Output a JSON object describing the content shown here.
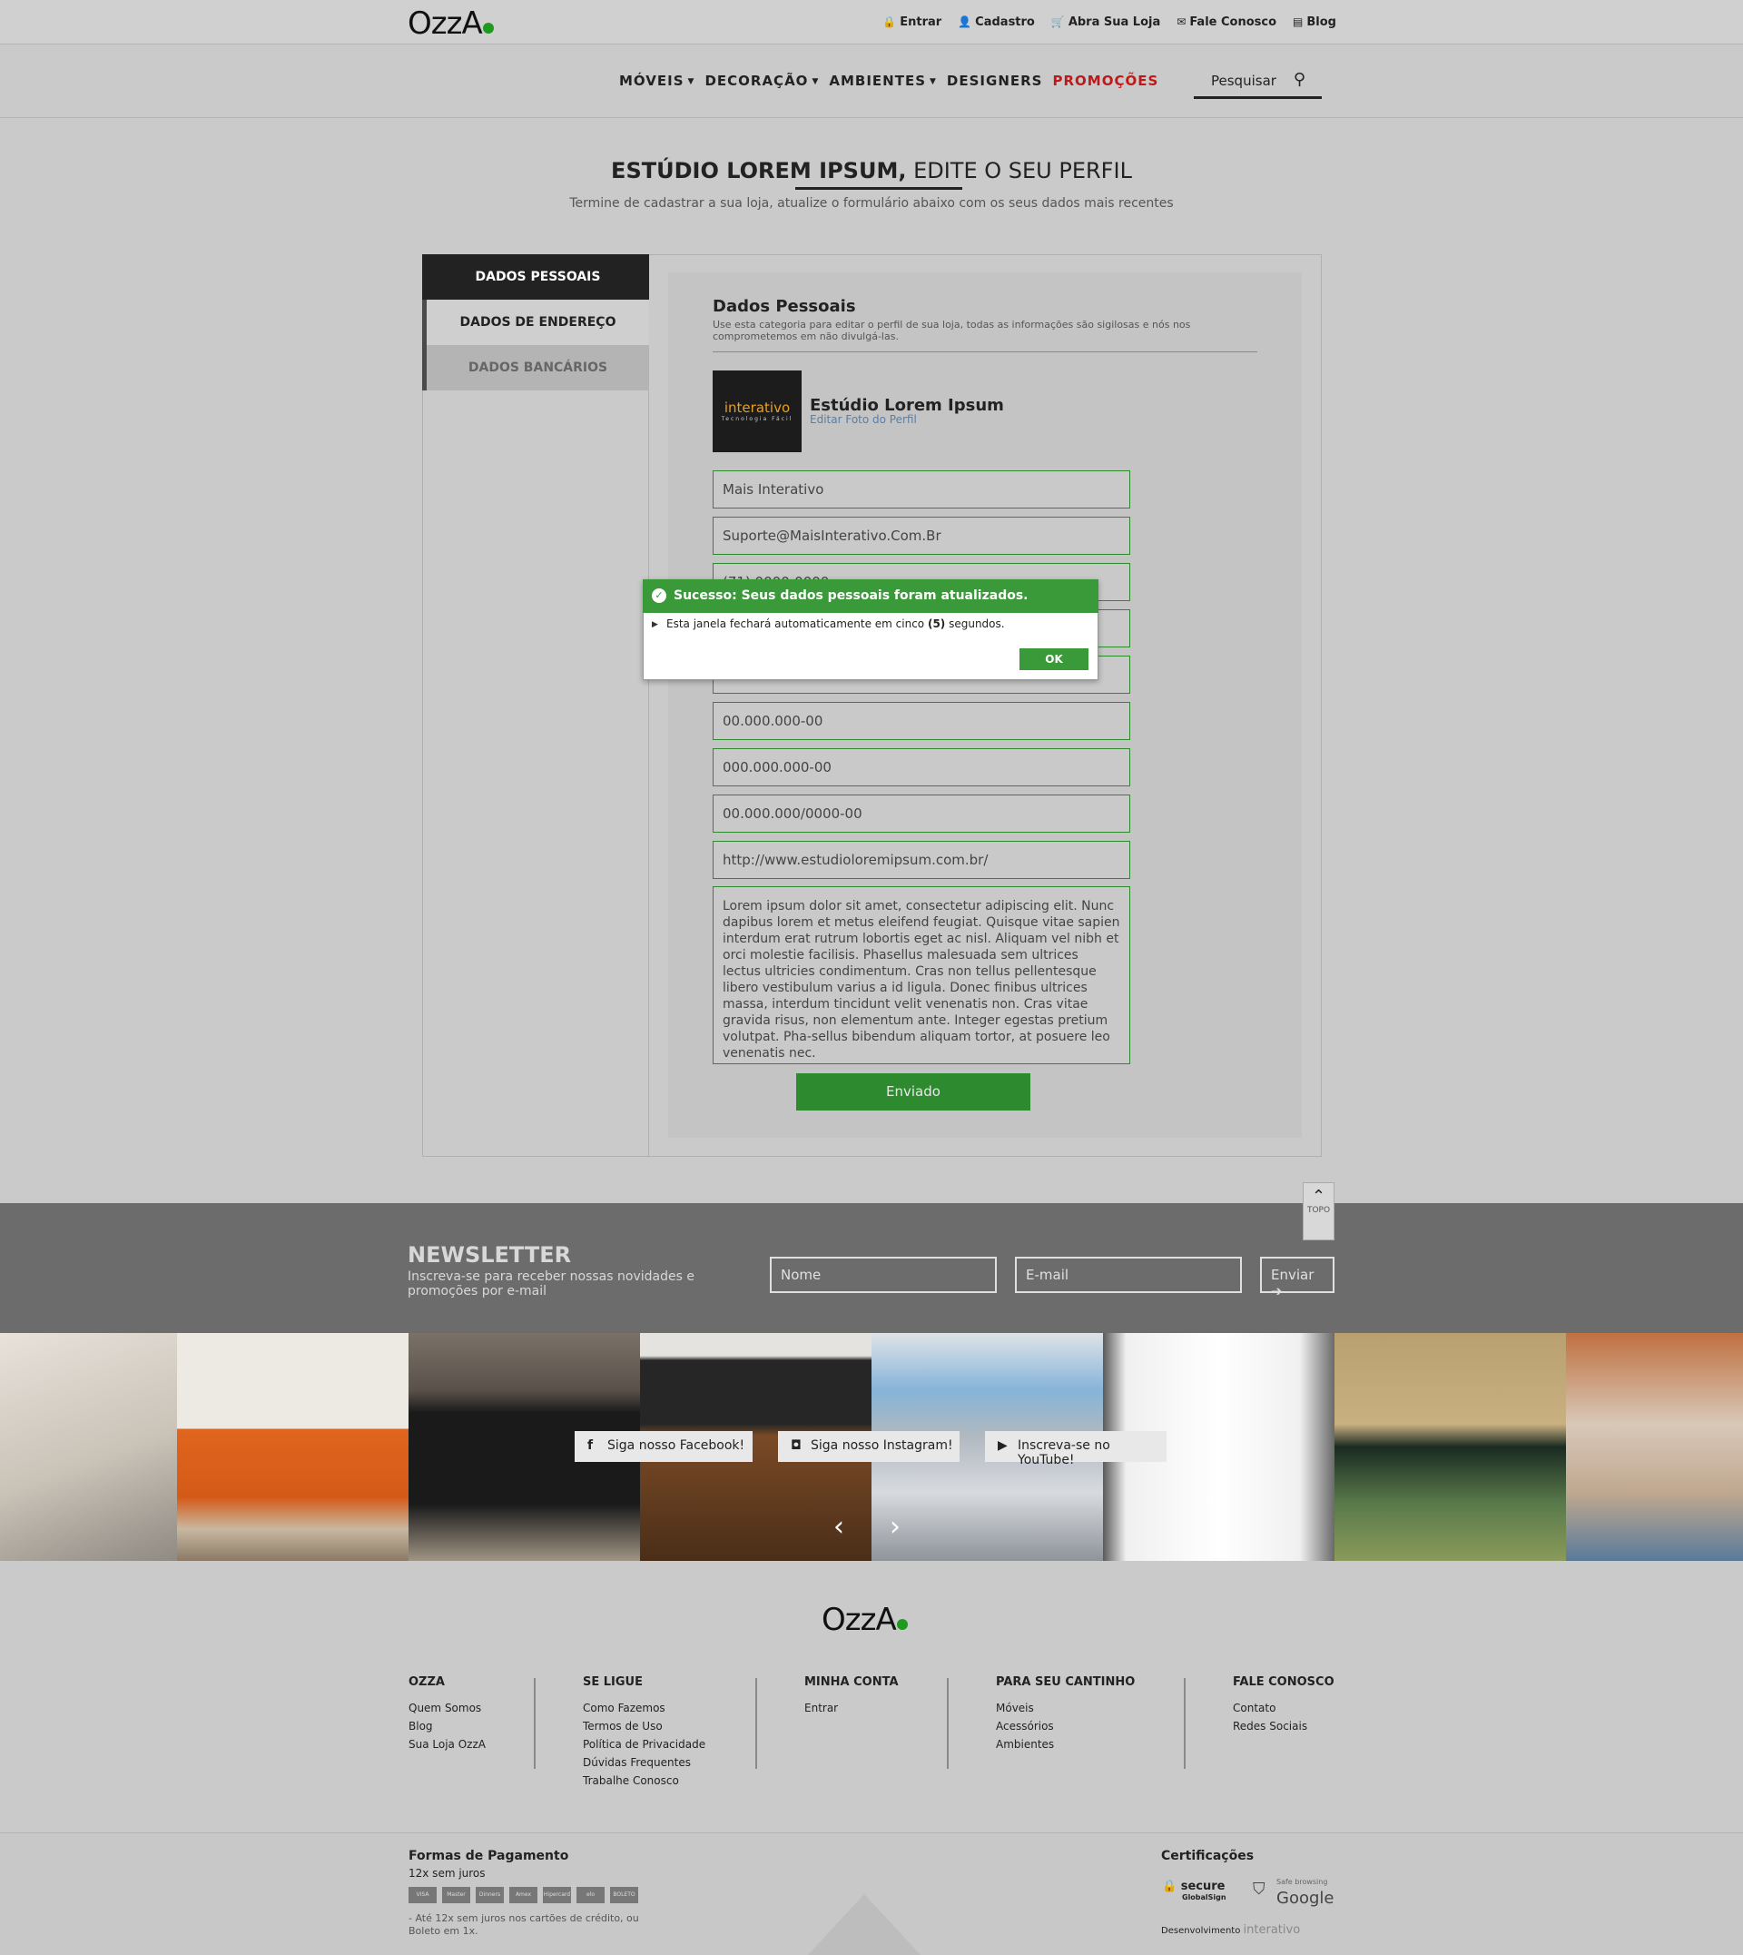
{
  "header": {
    "logo": "OzzA",
    "links": [
      {
        "icon": "lock-icon",
        "glyph": "🔒",
        "label": "Entrar"
      },
      {
        "icon": "user-icon",
        "glyph": "👤",
        "label": "Cadastro"
      },
      {
        "icon": "cart-icon",
        "glyph": "🛒",
        "label": "Abra Sua Loja"
      },
      {
        "icon": "mail-icon",
        "glyph": "✉",
        "label": "Fale Conosco"
      },
      {
        "icon": "blog-icon",
        "glyph": "▤",
        "label": "Blog"
      }
    ]
  },
  "nav": {
    "items": [
      "MÓVEIS",
      "DECORAÇÃO",
      "AMBIENTES",
      "DESIGNERS",
      "PROMOÇÕES"
    ],
    "search_placeholder": "Pesquisar"
  },
  "page": {
    "title_bold": "ESTÚDIO LOREM IPSUM,",
    "title_rest": " EDITE O SEU PERFIL",
    "subtitle": "Termine de cadastrar a sua loja, atualize o formulário abaixo com os seus dados mais recentes"
  },
  "sidebar": {
    "tabs": [
      "DADOS PESSOAIS",
      "DADOS DE ENDEREÇO",
      "DADOS BANCÁRIOS"
    ]
  },
  "form": {
    "section_title": "Dados Pessoais",
    "section_desc": "Use esta categoria para editar o perfil de sua loja, todas as informações são sigilosas e nós nos comprometemos em não divulgá-las.",
    "avatar_text": "interativo",
    "avatar_sub": "Tecnologia Fácil",
    "profile_name": "Estúdio Lorem Ipsum",
    "profile_link": "Editar Foto do Perfil",
    "fields": [
      "Mais Interativo",
      "Suporte@MaisInterativo.Com.Br",
      "(71) 0000-0000",
      "",
      "",
      "00.000.000-00",
      "000.000.000-00",
      "00.000.000/0000-00",
      "http://www.estudioloremipsum.com.br/"
    ],
    "about": "Lorem ipsum dolor sit amet, consectetur adipiscing elit. Nunc dapibus lorem et metus eleifend feugiat. Quisque vitae sapien interdum erat rutrum lobortis eget ac nisl. Aliquam vel nibh et orci molestie facilisis. Phasellus malesuada sem ultrices lectus ultricies condimentum. Cras non tellus pellentesque libero vestibulum varius a id ligula. Donec finibus ultrices massa, interdum tincidunt velit venenatis non. Cras vitae gravida risus, non elementum ante. Integer egestas pretium volutpat. Pha-sellus bibendum aliquam tortor, at posuere leo venenatis nec.",
    "submit_label": "Enviado"
  },
  "modal": {
    "title": "Sucesso: Seus dados pessoais foram atualizados.",
    "body_pre": "Esta janela fechará automaticamente em cinco ",
    "body_bold": "(5)",
    "body_post": " segundos.",
    "ok_label": "OK"
  },
  "newsletter": {
    "title": "NEWSLETTER",
    "subtitle": "Inscreva-se para receber nossas novidades e promoções por e-mail",
    "name_placeholder": "Nome",
    "email_placeholder": "E-mail",
    "submit_label": "Enviar ➔",
    "top_label": "TOPO"
  },
  "social": {
    "facebook": "Siga nosso Facebook!",
    "instagram": "Siga nosso Instagram!",
    "youtube": "Inscreva-se no YouTube!"
  },
  "footer": {
    "logo": "OzzA",
    "columns": [
      {
        "title": "OZZA",
        "links": [
          "Quem Somos",
          "Blog",
          "Sua Loja OzzA"
        ]
      },
      {
        "title": "SE LIGUE",
        "links": [
          "Como Fazemos",
          "Termos de Uso",
          "Política de Privacidade",
          "Dúvidas Frequentes",
          "Trabalhe Conosco"
        ]
      },
      {
        "title": "MINHA CONTA",
        "links": [
          "Entrar"
        ]
      },
      {
        "title": "PARA SEU CANTINHO",
        "links": [
          "Móveis",
          "Acessórios",
          "Ambientes"
        ]
      },
      {
        "title": "FALE CONOSCO",
        "links": [
          "Contato",
          "Redes Sociais"
        ]
      }
    ],
    "payment_title": "Formas de Pagamento",
    "payment_sub": "12x sem juros",
    "cards": [
      "VISA",
      "Master",
      "Dinners",
      "Amex",
      "Hipercard",
      "elo",
      "BOLETO"
    ],
    "payment_note": "- Até 12x sem juros nos cartões de crédito, ou Boleto em 1x.",
    "cert_title": "Certificações",
    "cert_secure": "secure",
    "cert_secure_sub": "GlobalSign",
    "cert_google_top": "Safe browsing",
    "cert_google": "Google",
    "dev_label": "Desenvolvimento",
    "dev_name": "interativo"
  },
  "colors": {
    "accent_green": "#2e8a2e",
    "promo_red": "#c01818",
    "dark": "#222222"
  }
}
